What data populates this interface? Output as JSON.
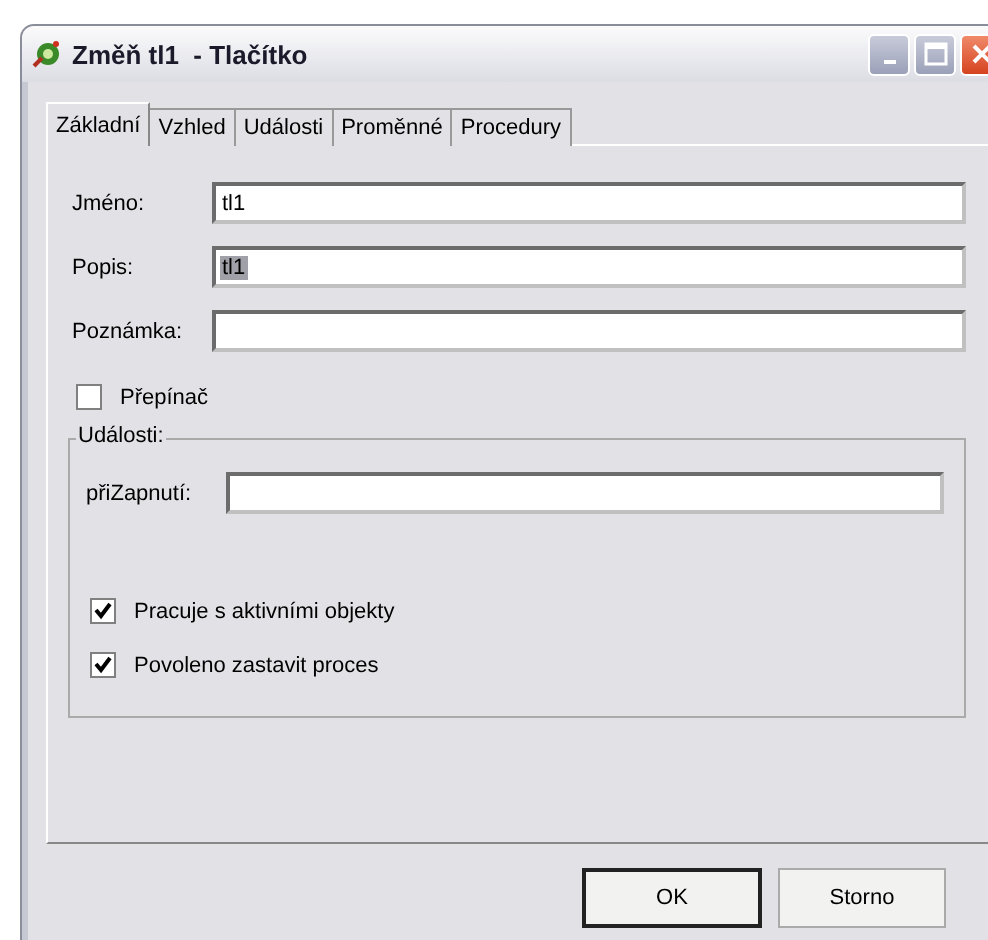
{
  "window": {
    "title": "Změň tl1  - Tlačítko"
  },
  "tabs": [
    {
      "label": "Základní",
      "selected": true
    },
    {
      "label": "Vzhled",
      "selected": false
    },
    {
      "label": "Události",
      "selected": false
    },
    {
      "label": "Proměnné",
      "selected": false
    },
    {
      "label": "Procedury",
      "selected": false
    }
  ],
  "fields": [
    {
      "label": "Jméno:",
      "value": "tl1"
    },
    {
      "label": "Popis:",
      "value": "tl1",
      "text_selected": true
    },
    {
      "label": "Poznámka:"
    }
  ],
  "switch": {
    "label": "Přepínač",
    "checked": false
  },
  "events_group": {
    "title": "Události:",
    "field": {
      "label": "přiZapnutí:"
    },
    "options": [
      {
        "label": "Pracuje s aktivními objekty",
        "checked": true
      },
      {
        "label": "Povoleno zastavit proces",
        "checked": true
      }
    ]
  },
  "buttons": [
    {
      "label": "OK",
      "default": true
    },
    {
      "label": "Storno",
      "default": false
    }
  ]
}
